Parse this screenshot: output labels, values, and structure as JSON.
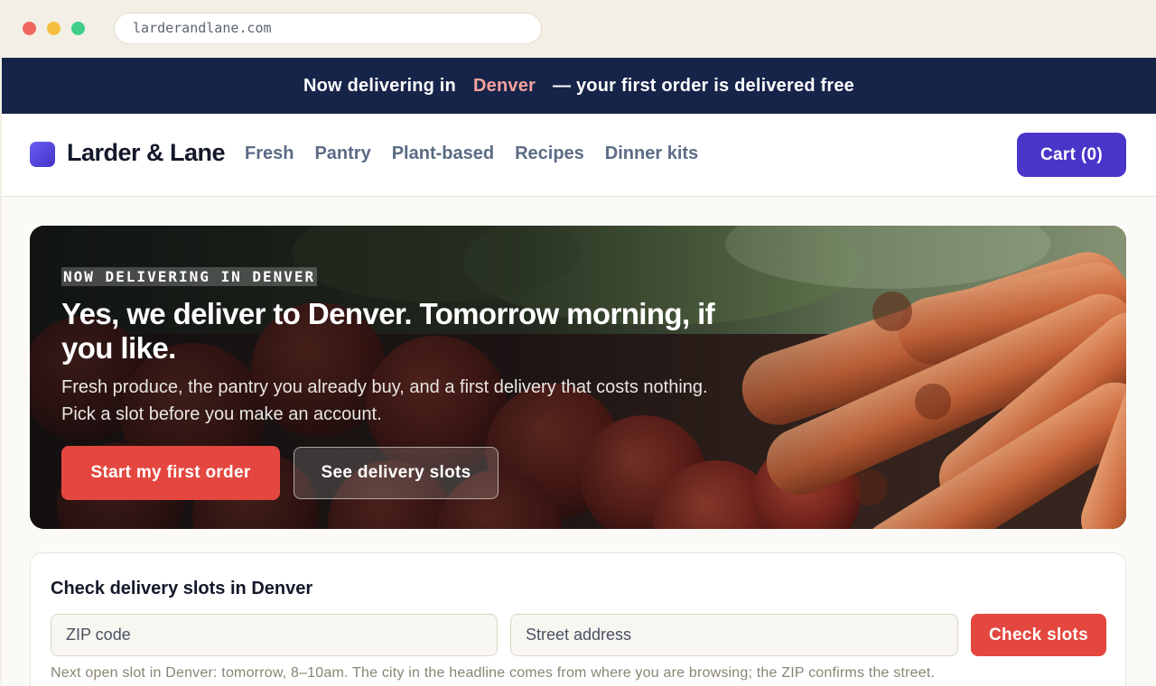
{
  "browser": {
    "url": "larderandlane.com"
  },
  "promo_bar": {
    "prefix": "Now delivering in",
    "city": "Denver",
    "suffix": "— your first order is delivered free"
  },
  "header": {
    "brand": "Larder & Lane",
    "nav": [
      "Fresh",
      "Pantry",
      "Plant-based",
      "Recipes",
      "Dinner kits"
    ],
    "cart_label": "Cart (0)"
  },
  "hero": {
    "eyebrow": "NOW DELIVERING IN DENVER",
    "title": "Yes, we deliver to Denver. Tomorrow morning, if you like.",
    "subtitle_line1": "Fresh produce, the pantry you already buy, and a first delivery that costs nothing.",
    "subtitle_line2": "Pick a slot before you make an account.",
    "primary_cta": "Start my first order",
    "secondary_cta": "See delivery slots"
  },
  "slot_checker": {
    "title": "Check delivery slots in Denver",
    "zip_placeholder": "ZIP code",
    "street_placeholder": "Street address",
    "button": "Check slots",
    "note": "Next open slot in Denver: tomorrow, 8–10am. The city in the headline comes from where you are browsing; the ZIP confirms the street."
  },
  "colors": {
    "promo_bg": "#17244a",
    "promo_city": "#f3a29c",
    "brand_accent": "#4a35c9",
    "cta_red": "#e4473f",
    "nav_text": "#5b6b85"
  },
  "icons": {
    "window_controls": [
      "close-dot",
      "minimize-dot",
      "maximize-dot"
    ],
    "logo": "square-logo-mark"
  }
}
